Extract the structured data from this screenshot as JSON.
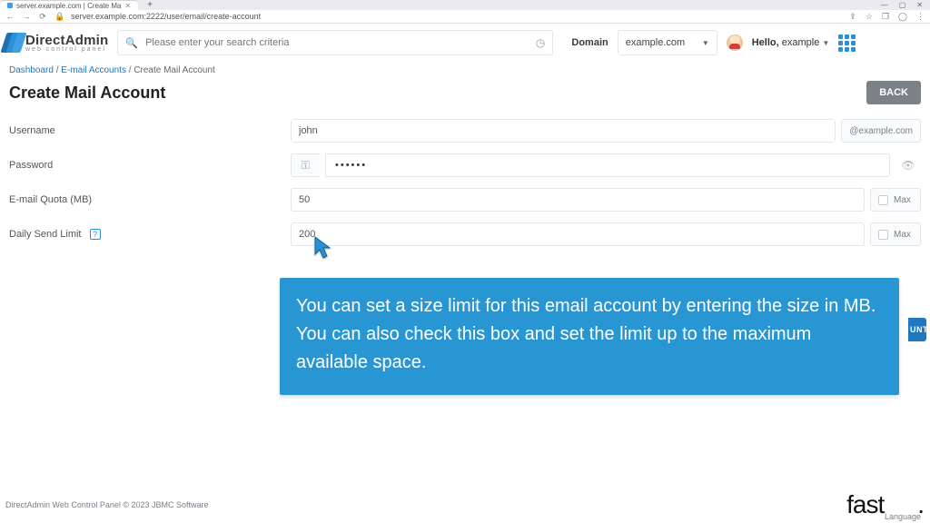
{
  "browser": {
    "tab_title": "server.example.com | Create Ma",
    "url": "server.example.com:2222/user/email/create-account"
  },
  "brand": {
    "name": "DirectAdmin",
    "tagline": "web control panel"
  },
  "search": {
    "placeholder": "Please enter your search criteria"
  },
  "header": {
    "domain_label": "Domain",
    "domain_value": "example.com",
    "hello_prefix": "Hello, ",
    "hello_name": "example"
  },
  "crumbs": {
    "a": "Dashboard",
    "b": "E-mail Accounts",
    "c": "Create Mail Account"
  },
  "page": {
    "title": "Create Mail Account",
    "back": "BACK"
  },
  "form": {
    "username_label": "Username",
    "username_value": "john",
    "username_suffix": "@example.com",
    "password_label": "Password",
    "password_value": "••••••",
    "quota_label": "E-mail Quota (MB)",
    "quota_value": "50",
    "quota_max": "Max",
    "send_label": "Daily Send Limit",
    "send_value": "200",
    "send_max": "Max"
  },
  "tip": "You can set a size limit for this email account by entering the size in MB. You can also check this box and set the limit up to the maximum available space.",
  "peek_button": "UNT",
  "footer": {
    "copyright": "DirectAdmin Web Control Panel © 2023 JBMC Software",
    "language": "Language"
  },
  "watermark": {
    "a": "fast",
    "b": "dot"
  }
}
